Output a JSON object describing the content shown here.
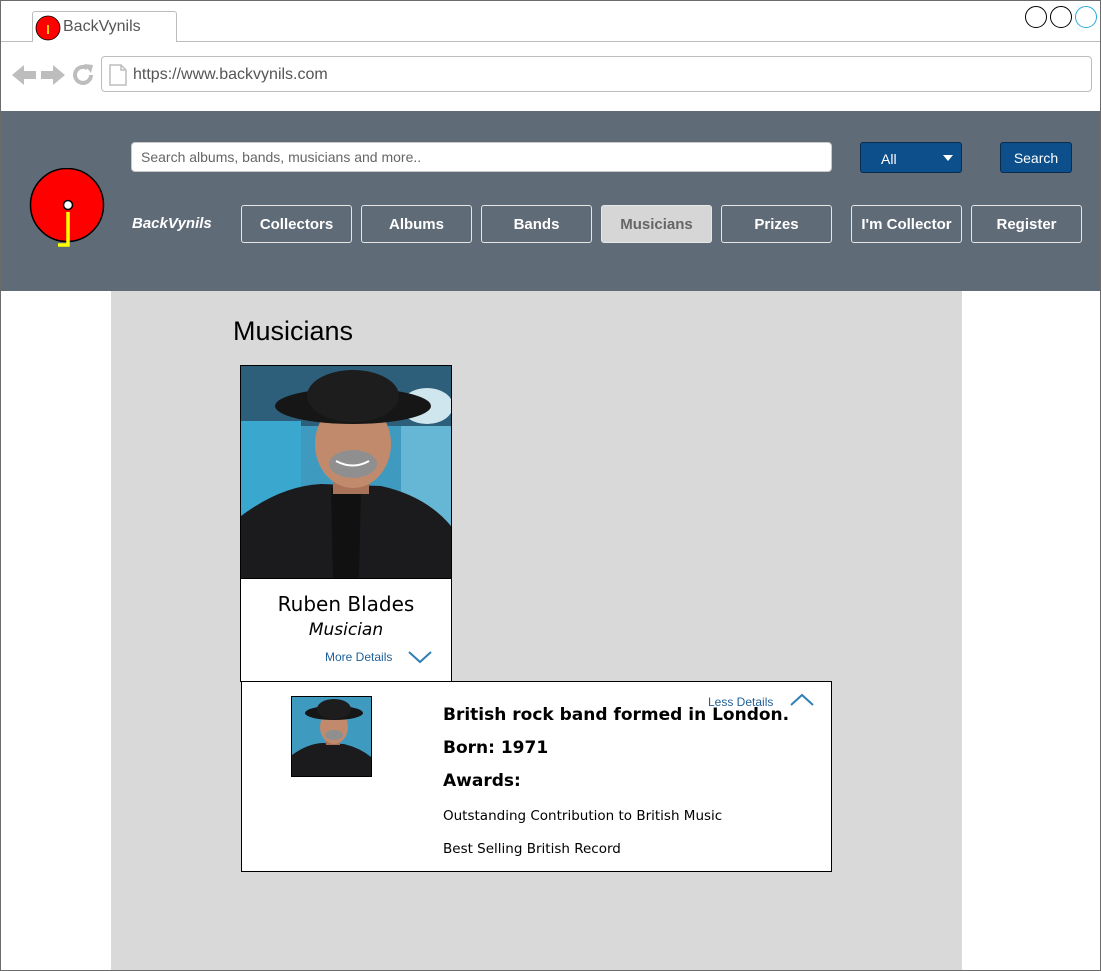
{
  "browser": {
    "tab_title": "BackVynils",
    "url": "https://www.backvynils.com"
  },
  "header": {
    "search_placeholder": "Search albums, bands, musicians and more..",
    "filter_selected": "All",
    "search_button": "Search",
    "brand": "BackVynils",
    "nav": [
      "Collectors",
      "Albums",
      "Bands",
      "Musicians",
      "Prizes"
    ],
    "active_nav": "Musicians",
    "collector_button": "I'm Collector",
    "register_button": "Register"
  },
  "main": {
    "title": "Musicians",
    "card": {
      "name": "Ruben Blades",
      "role": "Musician",
      "more_details": "More Details"
    },
    "details": {
      "less_details": "Less Details",
      "description": "British rock band formed in London.",
      "born": "Born: 1971",
      "awards_label": "Awards:",
      "awards": [
        "Outstanding Contribution to British Music",
        "Best Selling British Record"
      ]
    }
  },
  "colors": {
    "header_bg": "#606b78",
    "content_bg": "#d9d9d9",
    "primary_button": "#0c4f8b",
    "link": "#1f5f99",
    "logo_red": "#ff0000",
    "logo_accent": "#ffff00"
  },
  "icons": {
    "back": "back-arrow-icon",
    "forward": "forward-arrow-icon",
    "reload": "reload-icon",
    "page": "page-icon",
    "expand": "chevron-down-icon",
    "collapse": "chevron-up-icon"
  }
}
